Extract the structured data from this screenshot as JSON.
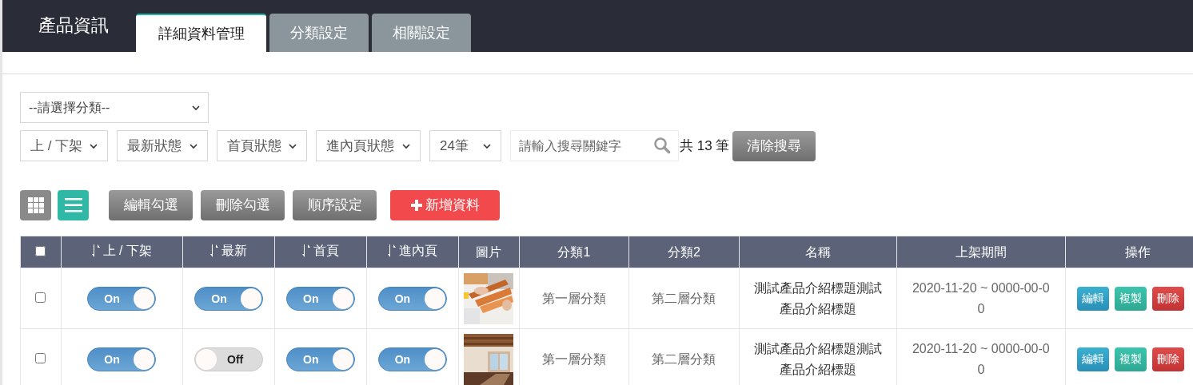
{
  "header": {
    "title": "產品資訊",
    "tabs": [
      {
        "label": "詳細資料管理",
        "selected": true
      },
      {
        "label": "分類設定",
        "selected": false
      },
      {
        "label": "相關設定",
        "selected": false
      }
    ]
  },
  "filters": {
    "category_select": "--請選擇分類--",
    "selects": [
      "上 / 下架",
      "最新狀態",
      "首頁狀態",
      "進內頁狀態",
      "24筆"
    ],
    "search_placeholder": "請輸入搜尋關鍵字",
    "count": "共 13 筆",
    "clear_button": "清除搜尋"
  },
  "view_toggles": [
    {
      "kind": "grid",
      "selected": false
    },
    {
      "kind": "list",
      "selected": true
    }
  ],
  "action_buttons": [
    {
      "label": "編輯勾選",
      "kind": "gray"
    },
    {
      "label": "刪除勾選",
      "kind": "gray"
    },
    {
      "label": "順序設定",
      "kind": "gray"
    },
    {
      "label": "新增資料",
      "kind": "add"
    }
  ],
  "table": {
    "select_all_checked": false,
    "columns": [
      {
        "label": "上 / 下架",
        "sortable": true
      },
      {
        "label": "最新",
        "sortable": true
      },
      {
        "label": "首頁",
        "sortable": true
      },
      {
        "label": "進內頁",
        "sortable": true
      },
      {
        "label": "圖片",
        "sortable": false
      },
      {
        "label": "分類1",
        "sortable": false
      },
      {
        "label": "分類2",
        "sortable": false
      },
      {
        "label": "名稱",
        "sortable": false
      },
      {
        "label": "上架期間",
        "sortable": false
      },
      {
        "label": "操作",
        "sortable": false
      }
    ],
    "rows": [
      {
        "checked": false,
        "toggles": [
          {
            "on": true,
            "label": "On"
          },
          {
            "on": true,
            "label": "On"
          },
          {
            "on": true,
            "label": "On"
          },
          {
            "on": true,
            "label": "On"
          }
        ],
        "picture": {
          "kind": "wood"
        },
        "category1": "第一層分類",
        "category2": "第二層分類",
        "name": "測試產品介紹標題測試產品介紹標題",
        "period": "2020-11-20 ~ 0000-00-00",
        "actions": [
          {
            "label": "編輯",
            "kind": "edit"
          },
          {
            "label": "複製",
            "kind": "copy"
          },
          {
            "label": "刪除",
            "kind": "delete"
          }
        ]
      },
      {
        "checked": false,
        "toggles": [
          {
            "on": true,
            "label": "On"
          },
          {
            "on": false,
            "label": "Off"
          },
          {
            "on": true,
            "label": "On"
          },
          {
            "on": true,
            "label": "On"
          }
        ],
        "picture": {
          "kind": "room"
        },
        "category1": "第一層分類",
        "category2": "第二層分類",
        "name": "測試產品介紹標題測試產品介紹標題",
        "period": "2020-11-20 ~ 0000-00-00",
        "actions": [
          {
            "label": "編輯",
            "kind": "edit"
          },
          {
            "label": "複製",
            "kind": "copy"
          },
          {
            "label": "刪除",
            "kind": "delete"
          }
        ]
      }
    ]
  }
}
